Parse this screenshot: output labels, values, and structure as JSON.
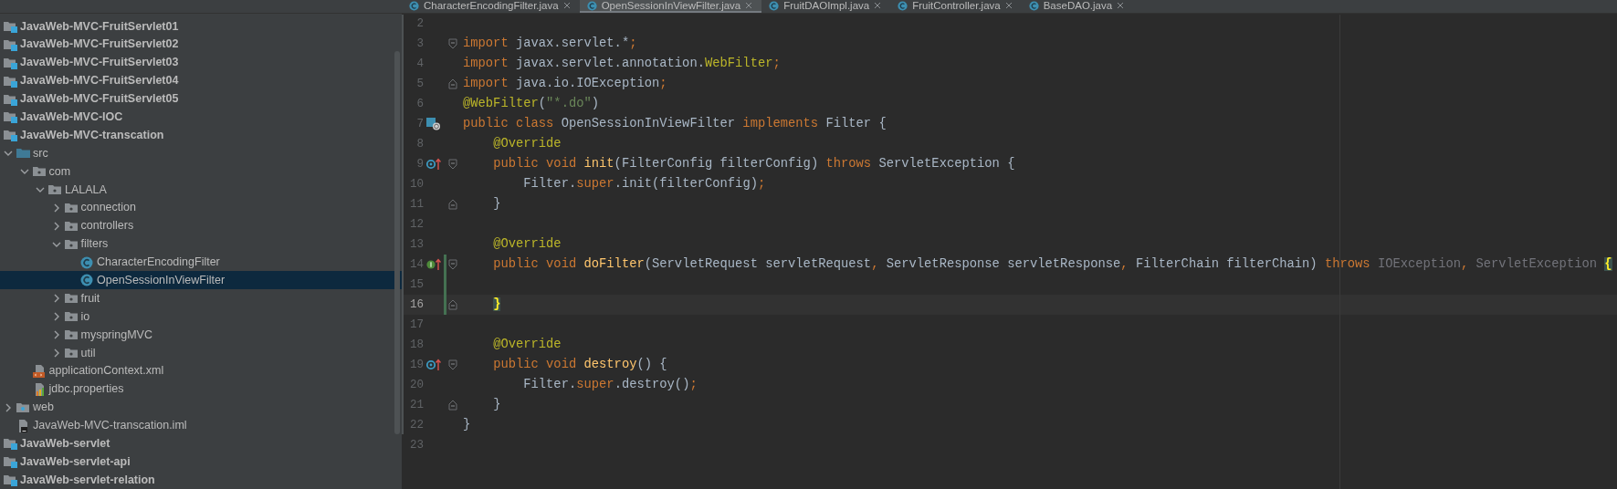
{
  "tabs": [
    {
      "label": "CharacterEncodingFilter.java",
      "selected": false
    },
    {
      "label": "OpenSessionInViewFilter.java",
      "selected": true
    },
    {
      "label": "FruitDAOImpl.java",
      "selected": false
    },
    {
      "label": "FruitController.java",
      "selected": false
    },
    {
      "label": "BaseDAO.java",
      "selected": false
    }
  ],
  "project_tree": [
    {
      "label": "JavaWeb-MVC-FruitServlet01",
      "kind": "module",
      "selected": false
    },
    {
      "label": "JavaWeb-MVC-FruitServlet02",
      "kind": "module",
      "selected": false
    },
    {
      "label": "JavaWeb-MVC-FruitServlet03",
      "kind": "module",
      "selected": false
    },
    {
      "label": "JavaWeb-MVC-FruitServlet04",
      "kind": "module",
      "selected": false
    },
    {
      "label": "JavaWeb-MVC-FruitServlet05",
      "kind": "module",
      "selected": false
    },
    {
      "label": "JavaWeb-MVC-IOC",
      "kind": "module",
      "selected": false
    },
    {
      "label": "JavaWeb-MVC-transcation",
      "kind": "module",
      "selected": false,
      "children": [
        {
          "label": "src",
          "kind": "source",
          "selected": false,
          "expanded": true,
          "children": [
            {
              "label": "com",
              "kind": "package",
              "selected": false,
              "expanded": true,
              "children": [
                {
                  "label": "LALALA",
                  "kind": "package",
                  "selected": false,
                  "expanded": true,
                  "children": [
                    {
                      "label": "connection",
                      "kind": "package",
                      "selected": false,
                      "expanded": false
                    },
                    {
                      "label": "controllers",
                      "kind": "package",
                      "selected": false,
                      "expanded": false
                    },
                    {
                      "label": "filters",
                      "kind": "package",
                      "selected": false,
                      "expanded": true,
                      "children": [
                        {
                          "label": "CharacterEncodingFilter",
                          "kind": "class",
                          "selected": false
                        },
                        {
                          "label": "OpenSessionInViewFilter",
                          "kind": "class",
                          "selected": true
                        }
                      ]
                    },
                    {
                      "label": "fruit",
                      "kind": "package",
                      "selected": false,
                      "expanded": false
                    },
                    {
                      "label": "io",
                      "kind": "package",
                      "selected": false,
                      "expanded": false
                    },
                    {
                      "label": "myspringMVC",
                      "kind": "package",
                      "selected": false,
                      "expanded": false
                    },
                    {
                      "label": "util",
                      "kind": "package",
                      "selected": false,
                      "expanded": false
                    }
                  ]
                }
              ]
            },
            {
              "label": "applicationContext.xml",
              "kind": "xml",
              "selected": false
            },
            {
              "label": "jdbc.properties",
              "kind": "properties",
              "selected": false
            }
          ]
        },
        {
          "label": "web",
          "kind": "web",
          "selected": false,
          "expanded": false
        },
        {
          "label": "JavaWeb-MVC-transcation.iml",
          "kind": "iml",
          "selected": false
        }
      ]
    },
    {
      "label": "JavaWeb-servlet",
      "kind": "module",
      "selected": false
    },
    {
      "label": "JavaWeb-servlet-api",
      "kind": "module",
      "selected": false
    },
    {
      "label": "JavaWeb-servlet-relation",
      "kind": "module",
      "selected": false
    }
  ],
  "editor": {
    "lines": [
      {
        "number": "2",
        "current": false,
        "changed": false
      },
      {
        "number": "3",
        "current": false,
        "changed": false,
        "fold": {
          "kind": "start"
        },
        "tokens": [
          {
            "text": "import",
            "kind": "keyword"
          },
          {
            "text": " javax.servlet.*",
            "kind": "plain"
          },
          {
            "text": ";",
            "kind": "keyword"
          }
        ]
      },
      {
        "number": "4",
        "current": false,
        "changed": false,
        "tokens": [
          {
            "text": "import",
            "kind": "keyword"
          },
          {
            "text": " javax.servlet.annotation.",
            "kind": "plain"
          },
          {
            "text": "WebFilter",
            "kind": "annotation"
          },
          {
            "text": ";",
            "kind": "keyword"
          }
        ]
      },
      {
        "number": "5",
        "current": false,
        "changed": false,
        "fold": {
          "kind": "end"
        },
        "tokens": [
          {
            "text": "import",
            "kind": "keyword"
          },
          {
            "text": " java.io.IOException",
            "kind": "plain"
          },
          {
            "text": ";",
            "kind": "keyword"
          }
        ]
      },
      {
        "number": "6",
        "current": false,
        "changed": false,
        "tokens": [
          {
            "text": "@WebFilter",
            "kind": "annotation"
          },
          {
            "text": "(",
            "kind": "plain"
          },
          {
            "text": "\"*.do\"",
            "kind": "string"
          },
          {
            "text": ")",
            "kind": "plain"
          }
        ]
      },
      {
        "number": "7",
        "current": false,
        "changed": false,
        "gutter_icon": {
          "kind": "web-class"
        },
        "tokens": [
          {
            "text": "public class",
            "kind": "keyword"
          },
          {
            "text": " OpenSessionInViewFilter ",
            "kind": "plain"
          },
          {
            "text": "implements",
            "kind": "keyword"
          },
          {
            "text": " Filter {",
            "kind": "plain"
          }
        ]
      },
      {
        "number": "8",
        "current": false,
        "changed": false,
        "tokens": [
          {
            "text": "    @Override",
            "kind": "annotation"
          }
        ]
      },
      {
        "number": "9",
        "current": false,
        "changed": false,
        "gutter_icon": {
          "kind": "override"
        },
        "fold": {
          "kind": "start"
        },
        "tokens": [
          {
            "text": "    public void ",
            "kind": "keyword"
          },
          {
            "text": "init",
            "kind": "method"
          },
          {
            "text": "(FilterConfig filterConfig) ",
            "kind": "plain"
          },
          {
            "text": "throws",
            "kind": "keyword"
          },
          {
            "text": " ServletException {",
            "kind": "plain"
          }
        ]
      },
      {
        "number": "10",
        "current": false,
        "changed": false,
        "tokens": [
          {
            "text": "        Filter.",
            "kind": "plain"
          },
          {
            "text": "super",
            "kind": "keyword"
          },
          {
            "text": ".init(filterConfig)",
            "kind": "plain"
          },
          {
            "text": ";",
            "kind": "keyword"
          }
        ]
      },
      {
        "number": "11",
        "current": false,
        "changed": false,
        "fold": {
          "kind": "end"
        },
        "tokens": [
          {
            "text": "    }",
            "kind": "plain"
          }
        ]
      },
      {
        "number": "12",
        "current": false,
        "changed": false
      },
      {
        "number": "13",
        "current": false,
        "changed": false,
        "tokens": [
          {
            "text": "    @Override",
            "kind": "annotation"
          }
        ]
      },
      {
        "number": "14",
        "current": false,
        "changed": true,
        "gutter_icon": {
          "kind": "implement"
        },
        "fold": {
          "kind": "start"
        },
        "tokens": [
          {
            "text": "    public void ",
            "kind": "keyword"
          },
          {
            "text": "doFilter",
            "kind": "method"
          },
          {
            "text": "(ServletRequest servletRequest",
            "kind": "plain"
          },
          {
            "text": ",",
            "kind": "keyword"
          },
          {
            "text": " ServletResponse servletResponse",
            "kind": "plain"
          },
          {
            "text": ",",
            "kind": "keyword"
          },
          {
            "text": " FilterChain filterChain) ",
            "kind": "plain"
          },
          {
            "text": "throws",
            "kind": "keyword"
          },
          {
            "text": " IOException",
            "kind": "unused"
          },
          {
            "text": ",",
            "kind": "keyword"
          },
          {
            "text": " ServletException ",
            "kind": "unused"
          },
          {
            "text": "{",
            "kind": "brace-match"
          }
        ]
      },
      {
        "number": "15",
        "current": false,
        "changed": true
      },
      {
        "number": "16",
        "current": true,
        "changed": true,
        "fold": {
          "kind": "end"
        },
        "tokens": [
          {
            "text": "    }",
            "kind": "brace-match"
          }
        ]
      },
      {
        "number": "17",
        "current": false,
        "changed": false
      },
      {
        "number": "18",
        "current": false,
        "changed": false,
        "tokens": [
          {
            "text": "    @Override",
            "kind": "annotation"
          }
        ]
      },
      {
        "number": "19",
        "current": false,
        "changed": false,
        "gutter_icon": {
          "kind": "override"
        },
        "fold": {
          "kind": "start"
        },
        "tokens": [
          {
            "text": "    public void ",
            "kind": "keyword"
          },
          {
            "text": "destroy",
            "kind": "method"
          },
          {
            "text": "() {",
            "kind": "plain"
          }
        ]
      },
      {
        "number": "20",
        "current": false,
        "changed": false,
        "tokens": [
          {
            "text": "        Filter.",
            "kind": "plain"
          },
          {
            "text": "super",
            "kind": "keyword"
          },
          {
            "text": ".destroy()",
            "kind": "plain"
          },
          {
            "text": ";",
            "kind": "keyword"
          }
        ]
      },
      {
        "number": "21",
        "current": false,
        "changed": false,
        "fold": {
          "kind": "end"
        },
        "tokens": [
          {
            "text": "    }",
            "kind": "plain"
          }
        ]
      },
      {
        "number": "22",
        "current": false,
        "changed": false,
        "tokens": [
          {
            "text": "}",
            "kind": "plain"
          }
        ]
      },
      {
        "number": "23",
        "current": false,
        "changed": false
      }
    ]
  }
}
